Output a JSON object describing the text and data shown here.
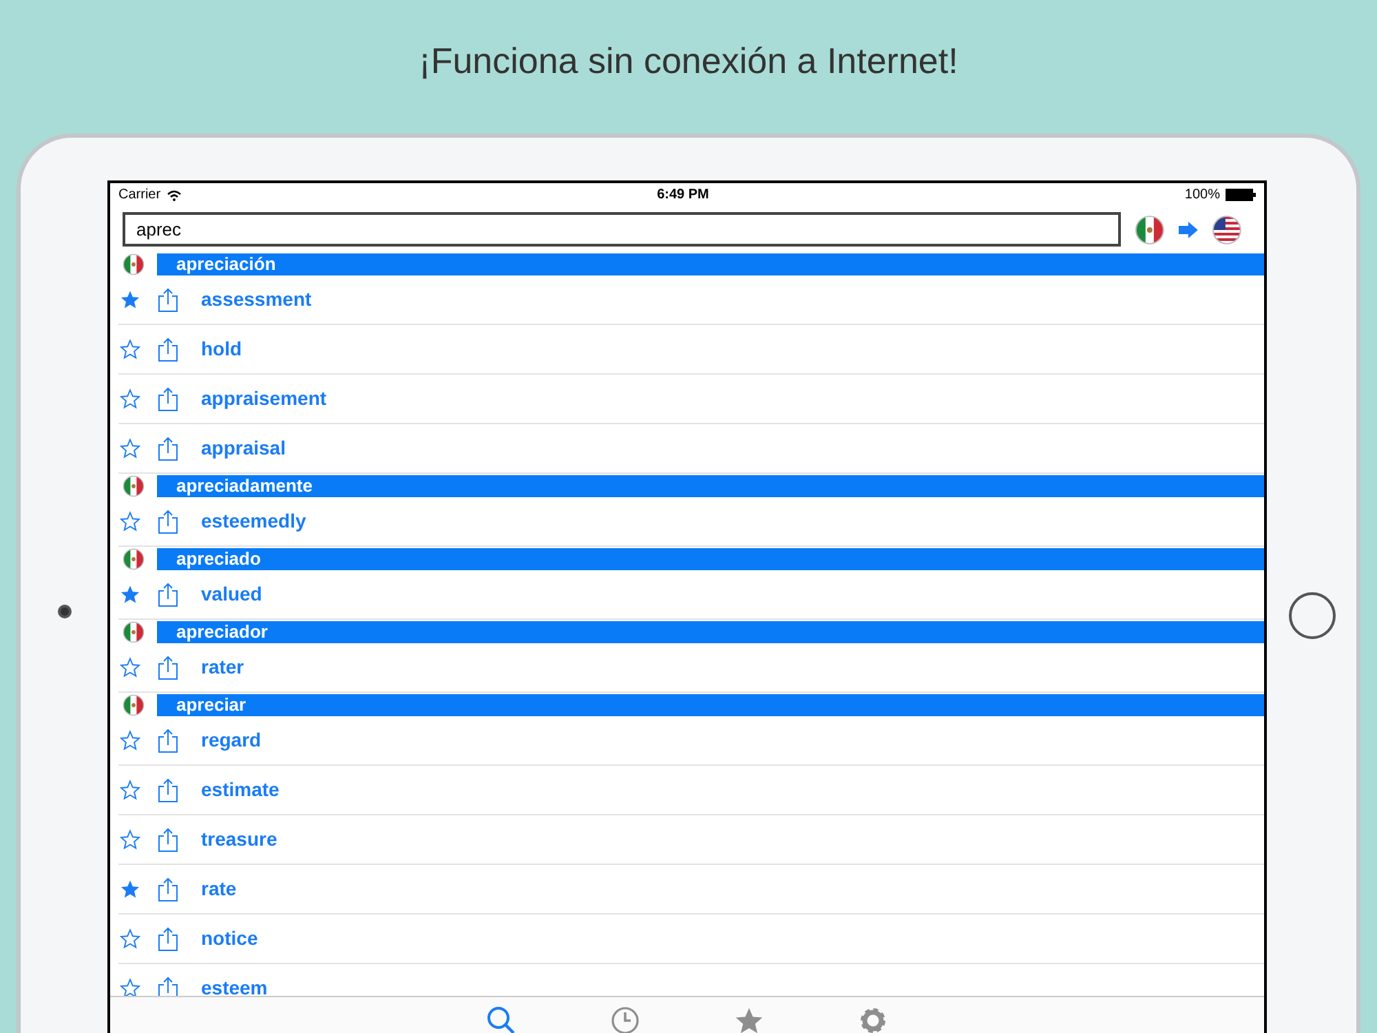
{
  "headline": "¡Funciona sin conexión a Internet!",
  "status_bar": {
    "carrier": "Carrier",
    "time": "6:49 PM",
    "battery": "100%"
  },
  "search": {
    "value": "aprec"
  },
  "entries": [
    {
      "headword": "apreciación",
      "translations": [
        {
          "word": "assessment",
          "starred": true
        },
        {
          "word": "hold",
          "starred": false
        },
        {
          "word": "appraisement",
          "starred": false
        },
        {
          "word": "appraisal",
          "starred": false
        }
      ]
    },
    {
      "headword": "apreciadamente",
      "translations": [
        {
          "word": "esteemedly",
          "starred": false
        }
      ]
    },
    {
      "headword": "apreciado",
      "translations": [
        {
          "word": "valued",
          "starred": true
        }
      ]
    },
    {
      "headword": "apreciador",
      "translations": [
        {
          "word": "rater",
          "starred": false
        }
      ]
    },
    {
      "headword": "apreciar",
      "translations": [
        {
          "word": "regard",
          "starred": false
        },
        {
          "word": "estimate",
          "starred": false
        },
        {
          "word": "treasure",
          "starred": false
        },
        {
          "word": "rate",
          "starred": true
        },
        {
          "word": "notice",
          "starred": false
        },
        {
          "word": "esteem",
          "starred": false
        }
      ]
    }
  ],
  "tabs": [
    {
      "kind": "search",
      "selected": true
    },
    {
      "kind": "history",
      "selected": false
    },
    {
      "kind": "favorites",
      "selected": false
    },
    {
      "kind": "settings",
      "selected": false
    }
  ]
}
